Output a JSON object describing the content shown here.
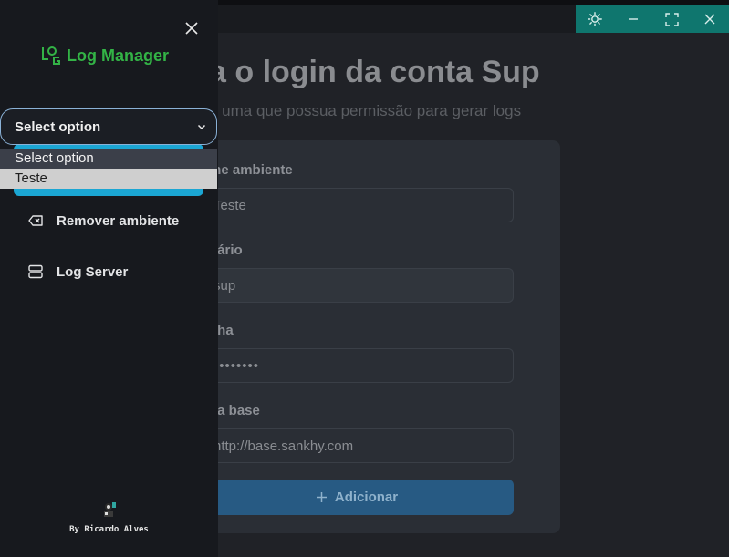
{
  "window": {
    "controls": [
      "sun-icon",
      "minimize-icon",
      "maximize-icon",
      "close-icon"
    ],
    "accent_color": "#0f766e"
  },
  "sidebar": {
    "logo_text": "Log Manager",
    "select": {
      "value": "Select option",
      "options": [
        "Select option",
        "Teste"
      ]
    },
    "items": [
      {
        "label": "Remover ambiente",
        "icon": "delete-backspace-icon"
      },
      {
        "label": "Log Server",
        "icon": "server-icon"
      }
    ],
    "credit": "By Ricardo Alves"
  },
  "main": {
    "title": "a o login da conta Sup",
    "subtitle": "e uma que possua permissão para gerar logs",
    "form": {
      "fields": [
        {
          "label": "me ambiente",
          "value": "Teste"
        },
        {
          "label": "uário",
          "value": "sup"
        },
        {
          "label": "nha",
          "value": "••••••••"
        },
        {
          "label": " da base",
          "value": "http://base.sankhy.com"
        }
      ],
      "submit_label": "Adicionar"
    }
  },
  "colors": {
    "brand_green": "#33b346",
    "select_border": "#8ab1d6",
    "highlight": "#1ba6d3",
    "button": "#275a83"
  }
}
